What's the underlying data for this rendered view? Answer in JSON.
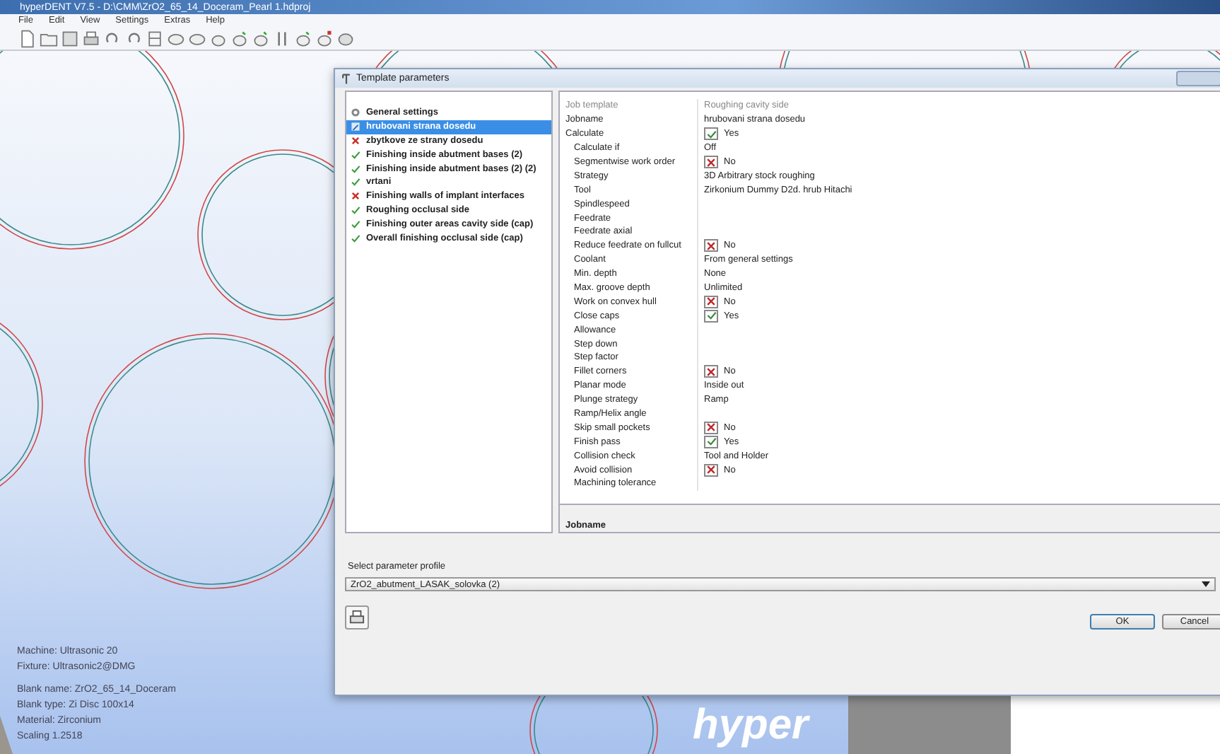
{
  "app": {
    "title": "hyperDENT V7.5 - D:\\CMM\\ZrO2_65_14_Doceram_Pearl 1.hdproj",
    "menu": [
      "File",
      "Edit",
      "View",
      "Settings",
      "Extras",
      "Help"
    ]
  },
  "viewport": {
    "info": [
      [
        "Machine: Ultrasonic 20",
        "Fixture: Ultrasonic2@DMG"
      ],
      [
        "Blank name: ZrO2_65_14_Doceram",
        "Blank type: Zi Disc 100x14",
        "Material: Zirconium",
        "Scaling 1.2518"
      ]
    ],
    "logo": "hyper"
  },
  "dialog": {
    "title": "Template parameters",
    "templates": [
      {
        "label": "General settings",
        "kind": "settings",
        "selected": false
      },
      {
        "label": "hrubovani strana dosedu",
        "kind": "edit",
        "selected": true
      },
      {
        "label": "zbytkove ze strany dosedu",
        "kind": "error",
        "selected": false
      },
      {
        "label": "Finishing inside abutment bases (2)",
        "kind": "ok",
        "selected": false
      },
      {
        "label": "Finishing inside abutment bases (2) (2)",
        "kind": "ok",
        "selected": false
      },
      {
        "label": "vrtani",
        "kind": "ok",
        "selected": false
      },
      {
        "label": "Finishing walls of implant interfaces",
        "kind": "error",
        "selected": false
      },
      {
        "label": "Roughing occlusal side",
        "kind": "ok",
        "selected": false
      },
      {
        "label": "Finishing outer areas cavity side (cap)",
        "kind": "ok",
        "selected": false
      },
      {
        "label": "Overall finishing occlusal side (cap)",
        "kind": "ok",
        "selected": false
      }
    ],
    "properties": [
      {
        "label": "Job template",
        "value": "Roughing cavity side",
        "kind": "header"
      },
      {
        "label": "Jobname",
        "value": "hrubovani strana dosedu",
        "kind": "text"
      },
      {
        "label": "Calculate",
        "value": "Yes",
        "kind": "yes",
        "children": [
          {
            "label": "Calculate if",
            "value": "Off",
            "kind": "text"
          },
          {
            "label": "Segmentwise work order",
            "value": "No",
            "kind": "no"
          },
          {
            "label": "Strategy",
            "value": "3D Arbitrary stock roughing",
            "kind": "text"
          },
          {
            "label": "Tool",
            "value": "Zirkonium Dummy D2d. hrub Hitachi",
            "kind": "text"
          },
          {
            "label": "Spindlespeed",
            "kind": "text"
          },
          {
            "label": "Feedrate",
            "kind": "text"
          },
          {
            "label": "Feedrate axial",
            "kind": "text"
          },
          {
            "label": "Reduce feedrate on fullcut",
            "value": "No",
            "kind": "no"
          },
          {
            "label": "Coolant",
            "value": "From general settings",
            "kind": "text"
          },
          {
            "label": "Min. depth",
            "value": "None",
            "kind": "text"
          },
          {
            "label": "Max. groove depth",
            "value": "Unlimited",
            "kind": "text"
          },
          {
            "label": "Work on convex hull",
            "value": "No",
            "kind": "no"
          },
          {
            "label": "Close caps",
            "value": "Yes",
            "kind": "yes"
          },
          {
            "label": "Allowance",
            "kind": "text"
          },
          {
            "label": "Step down",
            "kind": "text"
          },
          {
            "label": "Step factor",
            "kind": "text"
          },
          {
            "label": "Fillet corners",
            "value": "No",
            "kind": "no"
          },
          {
            "label": "Planar mode",
            "value": "Inside out",
            "kind": "text"
          },
          {
            "label": "Plunge strategy",
            "value": "Ramp",
            "kind": "text"
          },
          {
            "label": "Ramp/Helix angle",
            "kind": "text"
          },
          {
            "label": "Skip small pockets",
            "value": "No",
            "kind": "no"
          },
          {
            "label": "Finish pass",
            "value": "Yes",
            "kind": "yes"
          },
          {
            "label": "Collision check",
            "value": "Tool and Holder",
            "kind": "text"
          },
          {
            "label": "Avoid collision",
            "value": "No",
            "kind": "no"
          },
          {
            "label": "Machining tolerance",
            "kind": "text"
          }
        ]
      }
    ],
    "description_title": "Jobname",
    "profile_label": "Select parameter profile",
    "profile": {
      "value": "ZrO2_abutment_LASAK_solovka (2)"
    },
    "buttons": [
      "OK",
      "Cancel"
    ]
  }
}
